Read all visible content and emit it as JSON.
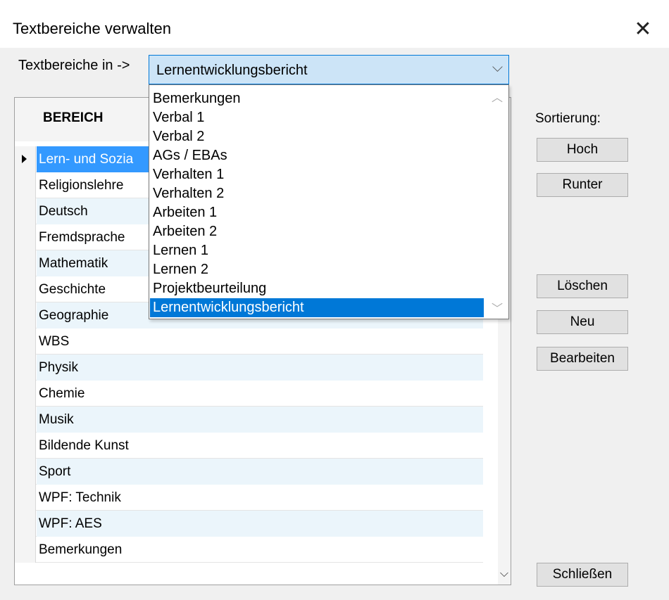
{
  "window": {
    "title": "Textbereiche verwalten"
  },
  "combo": {
    "label": "Textbereiche in ->",
    "value": "Lernentwicklungsbericht",
    "options": [
      "Bemerkungen",
      "Verbal 1",
      "Verbal 2",
      "AGs / EBAs",
      "Verhalten 1",
      "Verhalten 2",
      "Arbeiten 1",
      "Arbeiten 2",
      "Lernen 1",
      "Lernen 2",
      "Projektbeurteilung",
      "Lernentwicklungsbericht"
    ]
  },
  "grid": {
    "header": "BEREICH",
    "rows": [
      "Lern- und Sozia",
      "Religionslehre",
      "Deutsch",
      "Fremdsprache",
      "Mathematik",
      "Geschichte",
      "Geographie",
      "WBS",
      "Physik",
      "Chemie",
      "Musik",
      "Bildende Kunst",
      "Sport",
      "WPF: Technik",
      "WPF: AES",
      "Bemerkungen"
    ]
  },
  "side": {
    "sort_label": "Sortierung:",
    "up": "Hoch",
    "down": "Runter",
    "delete": "Löschen",
    "new": "Neu",
    "edit": "Bearbeiten",
    "close": "Schließen"
  },
  "icons": {
    "close": "close-icon",
    "combo_arrow": "chevron-down-icon"
  },
  "colors": {
    "selection": "#0078d7",
    "row_selected": "#3399ff",
    "row_alt": "#ebf5fb"
  }
}
